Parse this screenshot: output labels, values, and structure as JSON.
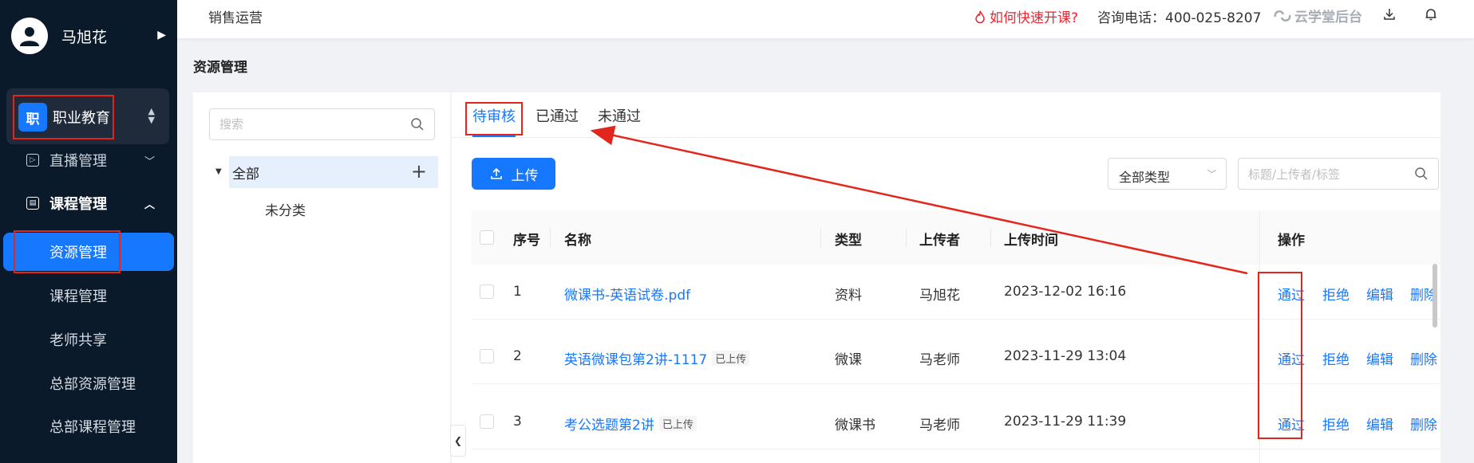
{
  "sidebar": {
    "user_name": "马旭花",
    "org": {
      "badge": "职",
      "name": "职业教育"
    },
    "groups": [
      {
        "label": "直播管理"
      },
      {
        "label": "课程管理"
      }
    ],
    "items": [
      {
        "label": "资源管理"
      },
      {
        "label": "课程管理"
      },
      {
        "label": "老师共享"
      },
      {
        "label": "总部资源管理"
      },
      {
        "label": "总部课程管理"
      }
    ]
  },
  "header": {
    "breadcrumb": "销售运营",
    "howto": "如何快速开课?",
    "phone": "咨询电话：400-025-8207",
    "brand": "云学堂后台"
  },
  "page": {
    "title": "资源管理"
  },
  "tree": {
    "search_placeholder": "搜索",
    "root": "全部",
    "child": "未分类"
  },
  "tabs": [
    {
      "label": "待审核"
    },
    {
      "label": "已通过"
    },
    {
      "label": "未通过"
    }
  ],
  "toolbar": {
    "upload_label": "上传",
    "type_select": "全部类型",
    "search_placeholder": "标题/上传者/标签"
  },
  "table": {
    "headers": [
      "序号",
      "名称",
      "类型",
      "上传者",
      "上传时间",
      "操作"
    ],
    "rows": [
      {
        "no": "1",
        "name": "微课书-英语试卷.pdf",
        "tag": "",
        "type": "资料",
        "uploader": "马旭花",
        "time": "2023-12-02 16:16"
      },
      {
        "no": "2",
        "name": "英语微课包第2讲-1117",
        "tag": "已上传",
        "type": "微课",
        "uploader": "马老师",
        "time": "2023-11-29 13:04"
      },
      {
        "no": "3",
        "name": "考公选题第2讲",
        "tag": "已上传",
        "type": "微课书",
        "uploader": "马老师",
        "time": "2023-11-29 11:39"
      }
    ],
    "actions": [
      "通过",
      "拒绝",
      "编辑",
      "删除"
    ]
  },
  "colors": {
    "accent": "#1677ff",
    "annotation": "#e3261c",
    "sidebar_bg": "#0b1a2b"
  }
}
